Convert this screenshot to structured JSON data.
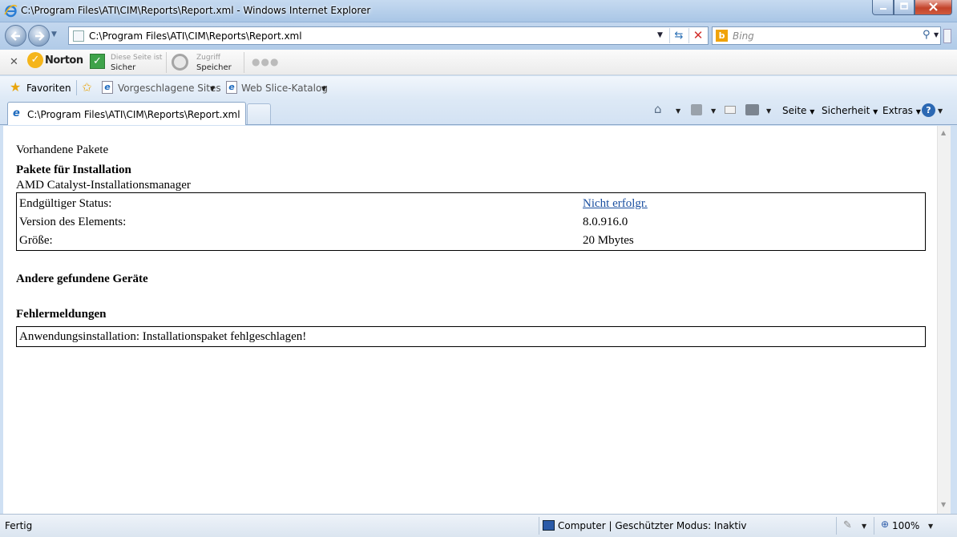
{
  "window": {
    "title": "C:\\Program Files\\ATI\\CIM\\Reports\\Report.xml - Windows Internet Explorer"
  },
  "navigation": {
    "address": "C:\\Program Files\\ATI\\CIM\\Reports\\Report.xml",
    "search_placeholder": "Bing"
  },
  "norton_toolbar": {
    "brand": "Norton",
    "safe_line1": "Diese Seite ist",
    "safe_line2": "Sicher",
    "access_line1": "Zugriff",
    "access_line2": "Speicher",
    "more": "●●●"
  },
  "favorites_bar": {
    "favorites_label": "Favoriten",
    "suggested_sites": "Vorgeschlagene Sites",
    "web_slice": "Web Slice-Katalog"
  },
  "tabs": [
    {
      "label": "C:\\Program Files\\ATI\\CIM\\Reports\\Report.xml"
    }
  ],
  "command_bar": {
    "page": "Seite",
    "safety": "Sicherheit",
    "extras": "Extras",
    "help": "?"
  },
  "report": {
    "heading_available": "Vorhandene Pakete",
    "heading_install": "Pakete für Installation",
    "package_name": "AMD Catalyst-Installationsmanager",
    "rows": [
      {
        "label": "Endgültiger Status:",
        "value": "Nicht erfolgr."
      },
      {
        "label": "Version des Elements:",
        "value": "8.0.916.0"
      },
      {
        "label": "Größe:",
        "value": "20 Mbytes"
      }
    ],
    "heading_devices": "Andere gefundene Geräte",
    "heading_errors": "Fehlermeldungen",
    "error_message": "Anwendungsinstallation: Installationspaket fehlgeschlagen!"
  },
  "statusbar": {
    "status": "Fertig",
    "zone": "Computer | Geschützter Modus: Inaktiv",
    "zoom": "100%"
  },
  "colors": {
    "link": "#1a4fa0",
    "close_button": "#c3432a",
    "frame": "#cfe0f3"
  }
}
